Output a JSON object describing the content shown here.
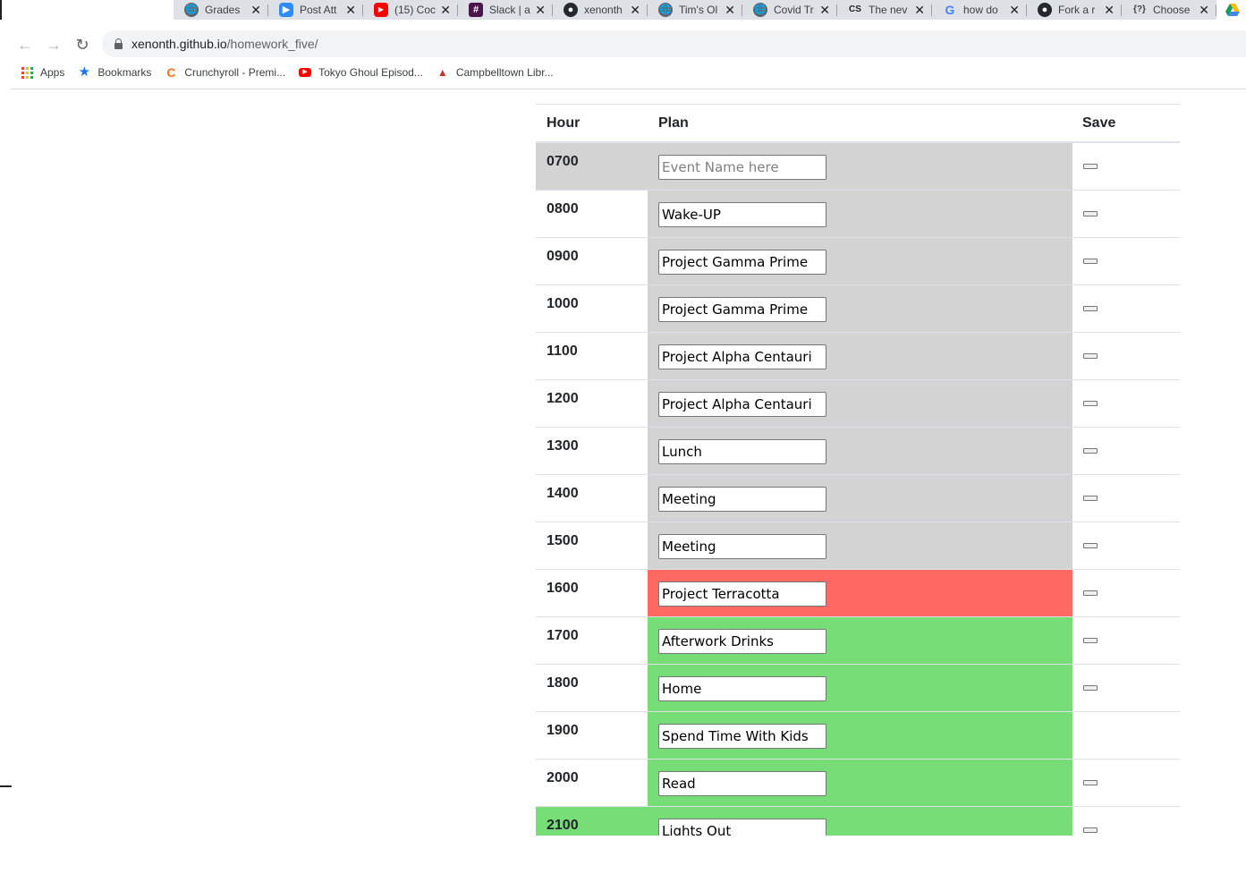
{
  "browser": {
    "tabs": [
      {
        "icon": "globe-icon",
        "icon_class": "fav-globe",
        "glyph": "🌐",
        "title": "Grades"
      },
      {
        "icon": "zoom-icon",
        "icon_class": "fav-zoom",
        "glyph": "▶",
        "title": "Post Att"
      },
      {
        "icon": "youtube-icon",
        "icon_class": "fav-yt",
        "glyph": "▶",
        "title": "(15) Coc"
      },
      {
        "icon": "slack-icon",
        "icon_class": "fav-slack",
        "glyph": "#",
        "title": "Slack | a"
      },
      {
        "icon": "github-icon",
        "icon_class": "fav-gh",
        "glyph": "●",
        "title": "xenonth"
      },
      {
        "icon": "globe-icon",
        "icon_class": "fav-globe",
        "glyph": "🌐",
        "title": "Tim's Ol"
      },
      {
        "icon": "globe-icon",
        "icon_class": "fav-globe",
        "glyph": "🌐",
        "title": "Covid Tr"
      },
      {
        "icon": "cs-icon",
        "icon_class": "fav-cs",
        "glyph": "CS",
        "title": "The nev"
      },
      {
        "icon": "google-icon",
        "icon_class": "fav-google",
        "glyph": "G",
        "title": "how do"
      },
      {
        "icon": "github-icon",
        "icon_class": "fav-gh",
        "glyph": "●",
        "title": "Fork a r"
      },
      {
        "icon": "question-icon",
        "icon_class": "fav-q",
        "glyph": "{?}",
        "title": "Choose"
      }
    ],
    "close_glyph": "✕",
    "nav": {
      "back": "←",
      "forward": "→",
      "reload": "↻"
    },
    "url": {
      "host": "xenonth.github.io",
      "path": "/homework_five/"
    },
    "bookmarks": [
      {
        "label": "Apps"
      },
      {
        "label": "Bookmarks"
      },
      {
        "label": "Crunchyroll - Premi..."
      },
      {
        "label": "Tokyo Ghoul Episod..."
      },
      {
        "label": "Campbelltown Libr..."
      }
    ]
  },
  "planner": {
    "headers": {
      "hour": "Hour",
      "plan": "Plan",
      "save": "Save"
    },
    "placeholder": "Event Name here",
    "rows": [
      {
        "hour": "0700",
        "plan": "",
        "status": "past",
        "save": true,
        "hour_highlight": "past"
      },
      {
        "hour": "0800",
        "plan": "Wake-UP",
        "status": "past",
        "save": true,
        "hour_highlight": ""
      },
      {
        "hour": "0900",
        "plan": "Project Gamma Prime",
        "status": "past",
        "save": true,
        "hour_highlight": ""
      },
      {
        "hour": "1000",
        "plan": "Project Gamma Prime",
        "status": "past",
        "save": true,
        "hour_highlight": ""
      },
      {
        "hour": "1100",
        "plan": "Project Alpha Centauri",
        "status": "past",
        "save": true,
        "hour_highlight": ""
      },
      {
        "hour": "1200",
        "plan": "Project Alpha Centauri",
        "status": "past",
        "save": true,
        "hour_highlight": ""
      },
      {
        "hour": "1300",
        "plan": "Lunch",
        "status": "past",
        "save": true,
        "hour_highlight": ""
      },
      {
        "hour": "1400",
        "plan": "Meeting",
        "status": "past",
        "save": true,
        "hour_highlight": ""
      },
      {
        "hour": "1500",
        "plan": "Meeting",
        "status": "past",
        "save": true,
        "hour_highlight": ""
      },
      {
        "hour": "1600",
        "plan": "Project Terracotta",
        "status": "present",
        "save": true,
        "hour_highlight": ""
      },
      {
        "hour": "1700",
        "plan": "Afterwork Drinks",
        "status": "future",
        "save": true,
        "hour_highlight": ""
      },
      {
        "hour": "1800",
        "plan": "Home",
        "status": "future",
        "save": true,
        "hour_highlight": ""
      },
      {
        "hour": "1900",
        "plan": "Spend Time With Kids",
        "status": "future",
        "save": false,
        "hour_highlight": ""
      },
      {
        "hour": "2000",
        "plan": "Read",
        "status": "future",
        "save": true,
        "hour_highlight": ""
      },
      {
        "hour": "2100",
        "plan": "Lights Out",
        "status": "future",
        "save": true,
        "hour_highlight": "future"
      }
    ]
  },
  "colors": {
    "past": "#d3d3d3",
    "present": "#ff6961",
    "future": "#77dd77"
  }
}
